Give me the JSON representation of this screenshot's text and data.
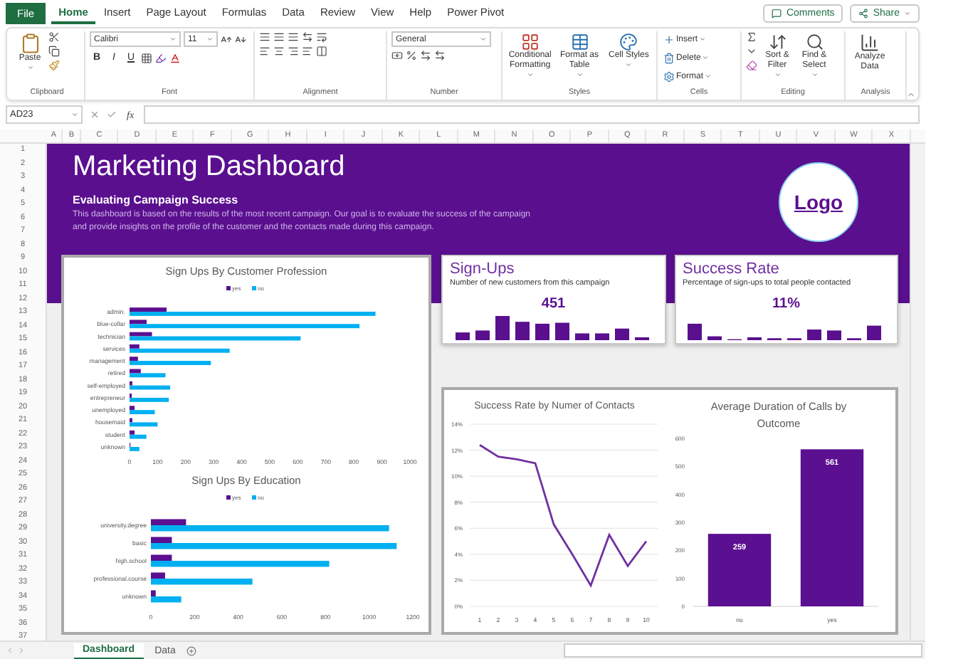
{
  "menu": {
    "file_button": "File",
    "tabs": [
      {
        "label": "Home",
        "selected": true
      },
      {
        "label": "Insert",
        "selected": false
      },
      {
        "label": "Page Layout",
        "selected": false
      },
      {
        "label": "Formulas",
        "selected": false
      },
      {
        "label": "Data",
        "selected": false
      },
      {
        "label": "Review",
        "selected": false
      },
      {
        "label": "View",
        "selected": false
      },
      {
        "label": "Help",
        "selected": false
      },
      {
        "label": "Power Pivot",
        "selected": false
      }
    ],
    "comments_button": "Comments",
    "share_button": "Share"
  },
  "ribbon": {
    "groups": [
      {
        "kind": "clipboard",
        "label": "Clipboard",
        "paste": "Paste"
      },
      {
        "kind": "font",
        "label": "Font",
        "font_name": "Calibri",
        "font_size": "11",
        "styles": [
          "B",
          "I",
          "U"
        ]
      },
      {
        "kind": "alignment",
        "label": "Alignment"
      },
      {
        "kind": "number",
        "label": "Number",
        "format": "General"
      },
      {
        "kind": "styles",
        "label": "Styles",
        "buttons": [
          "Conditional Formatting",
          "Format as Table",
          "Cell Styles"
        ]
      },
      {
        "kind": "cells",
        "label": "Cells",
        "buttons": [
          "Insert",
          "Delete",
          "Format"
        ]
      },
      {
        "kind": "editing",
        "label": "Editing",
        "buttons": [
          "Sort & Filter",
          "Find & Select"
        ]
      },
      {
        "kind": "analysis",
        "label": "Analysis",
        "buttons": [
          "Analyze Data"
        ]
      }
    ]
  },
  "formula_bar": {
    "name_box": "AD23",
    "function_label": "fx"
  },
  "column_headers": [
    "A",
    "B",
    "C",
    "D",
    "E",
    "F",
    "G",
    "H",
    "I",
    "J",
    "K",
    "L",
    "M",
    "N",
    "O",
    "P",
    "Q",
    "R",
    "S",
    "T",
    "U",
    "V",
    "W",
    "X"
  ],
  "row_headers": [
    "1",
    "2",
    "3",
    "4",
    "5",
    "6",
    "7",
    "8",
    "9",
    "10",
    "11",
    "12",
    "13",
    "14",
    "15",
    "16",
    "17",
    "18",
    "19",
    "20",
    "21",
    "22",
    "23",
    "24",
    "25",
    "26",
    "27",
    "28",
    "29",
    "30",
    "31",
    "32",
    "33",
    "34",
    "35",
    "36",
    "37"
  ],
  "dashboard": {
    "title": "Marketing Dashboard",
    "subtitle": "Evaluating Campaign Success",
    "description": "This dashboard is based on the results of the most recent campaign. Our goal is to evaluate the success of the campaign and provide insights on the profile of the customer and the contacts made during this campaign.",
    "logo": "Logo",
    "profession_chart": {
      "chart_data": {
        "type": "bar",
        "orientation": "horizontal",
        "title": "Sign Ups By Customer Profession",
        "categories": [
          "admin.",
          "blue-collar",
          "technician",
          "services",
          "management",
          "retired",
          "self-employed",
          "entrepreneur",
          "unemployed",
          "housemaid",
          "student",
          "unknown"
        ],
        "series": [
          {
            "name": "yes",
            "color": "#5b0f91",
            "values": [
              132,
              61,
              80,
              35,
              30,
              40,
              10,
              8,
              18,
              10,
              18,
              3
            ]
          },
          {
            "name": "no",
            "color": "#00b0f0",
            "values": [
              877,
              820,
              610,
              357,
              290,
              128,
              145,
              140,
              90,
              100,
              60,
              35
            ]
          }
        ],
        "legend": true,
        "xlim": [
          0,
          1000
        ],
        "xticks": [
          0,
          100,
          200,
          300,
          400,
          500,
          600,
          700,
          800,
          900,
          1000
        ]
      }
    },
    "education_chart": {
      "chart_data": {
        "type": "bar",
        "orientation": "horizontal",
        "title": "Sign Ups By Education",
        "categories": [
          "university.degree",
          "basic",
          "high.school",
          "professional.course",
          "unknown"
        ],
        "series": [
          {
            "name": "yes",
            "color": "#5b0f91",
            "values": [
              161,
              96,
              96,
              65,
              22
            ]
          },
          {
            "name": "no",
            "color": "#00b0f0",
            "values": [
              1091,
              1126,
              817,
              465,
              139
            ]
          }
        ],
        "legend": true,
        "xlim": [
          0,
          1200
        ],
        "xticks": [
          0,
          200,
          400,
          600,
          800,
          1000,
          1200
        ]
      }
    },
    "kpis": [
      {
        "title": "Sign-Ups",
        "subtitle": "Number of new customers from this campaign",
        "value": "451"
      },
      {
        "title": "Success Rate",
        "subtitle": "Percentage of sign-ups to total people contacted",
        "value": "11%"
      }
    ],
    "contacts_chart": {
      "chart_data": {
        "type": "line",
        "title": "Success Rate by Numer of Contacts",
        "x": [
          "1",
          "2",
          "3",
          "4",
          "5",
          "6",
          "7",
          "8",
          "9",
          "10"
        ],
        "grid": true,
        "series": [
          {
            "color": "#7030a0",
            "values": [
              12.4,
              11.5,
              11.3,
              11.0,
              6.3,
              4.0,
              1.6,
              5.5,
              3.1,
              5.0
            ]
          }
        ],
        "ylim": [
          0,
          14
        ],
        "yticks": [
          {
            "value": 0,
            "label": "0%"
          },
          {
            "value": 2,
            "label": "2%"
          },
          {
            "value": 4,
            "label": "4%"
          },
          {
            "value": 6,
            "label": "6%"
          },
          {
            "value": 8,
            "label": "8%"
          },
          {
            "value": 10,
            "label": "10%"
          },
          {
            "value": 12,
            "label": "12%"
          },
          {
            "value": 14,
            "label": "14%"
          }
        ]
      }
    },
    "duration_chart": {
      "chart_data": {
        "type": "bar",
        "title": "Average Duration of Calls by Outcome",
        "categories": [
          "no",
          "yes"
        ],
        "series": [
          {
            "color": "#5b0f91",
            "values": [
              259,
              561
            ]
          }
        ],
        "ylim": [
          0,
          600
        ],
        "yticks": [
          0,
          100,
          200,
          300,
          400,
          500,
          600
        ],
        "data_labels": true
      }
    }
  },
  "sheet_tabs": [
    {
      "label": "Dashboard",
      "selected": true
    },
    {
      "label": "Data",
      "selected": false
    }
  ]
}
